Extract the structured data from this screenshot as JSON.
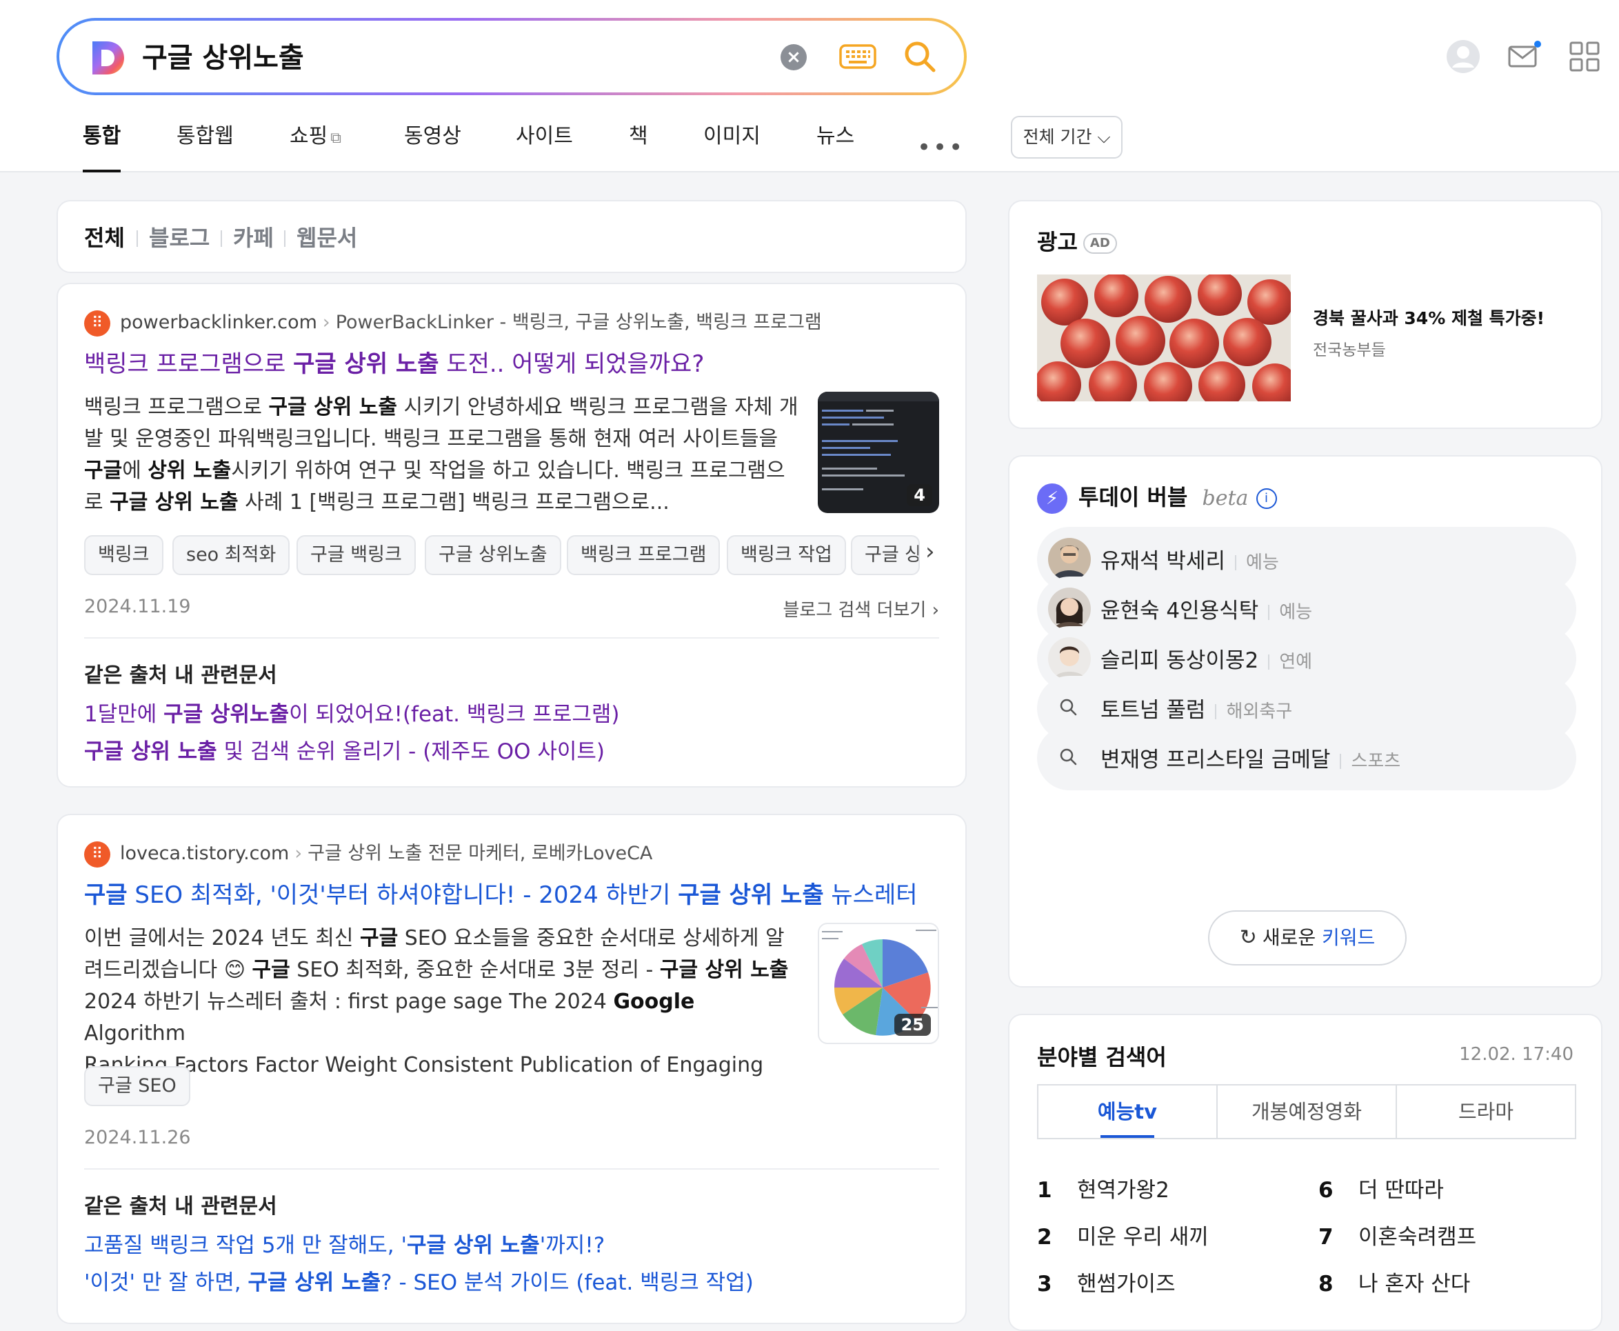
{
  "search": {
    "query": "구글 상위노출",
    "clear_glyph": "×",
    "icons": [
      "daum-logo-icon",
      "clear-icon",
      "keyboard-icon",
      "search-icon"
    ]
  },
  "header_icons": [
    "user-icon",
    "mail-icon",
    "grid-menu-icon"
  ],
  "tabs": [
    "통합",
    "통합웹",
    "쇼핑",
    "동영상",
    "사이트",
    "책",
    "이미지",
    "뉴스"
  ],
  "tabs_more": "•••",
  "period": "전체 기간 ⌵",
  "filters": [
    "전체",
    "블로그",
    "카페",
    "웹문서"
  ],
  "results": [
    {
      "domain": "powerbacklinker.com",
      "breadcrumb": "PowerBackLinker - 백링크, 구글 상위노출, 백링크 프로그램",
      "title_pre": "백링크 프로그램으로 ",
      "title_bold": "구글 상위 노출",
      "title_post": " 도전.. 어떻게 되었을까요?",
      "snippet": [
        [
          "백링크 프로그램으로 ",
          "구글 상위 노출",
          " 시키기 안녕하세요 백링크 프로그램을 자체 개"
        ],
        [
          "발 및 운영중인 파워백링크입니다. 백링크 프로그램을 통해 현재 여러 사이트들을",
          "",
          ""
        ],
        [
          "",
          "구글",
          "에 "
        ],
        [
          "로 ",
          "구글 상위 노출",
          " 사례 1 [백링크 프로그램] 백링크 프로그램으로..."
        ]
      ],
      "snippet_line3_b": "상위 노출",
      "snippet_line3_post": "시키기 위하여 연구 및 작업을 하고 있습니다. 백링크 프로그램으",
      "thumb_count": "4",
      "tags": [
        "백링크",
        "seo 최적화",
        "구글 백링크",
        "구글 상위노출",
        "백링크 프로그램",
        "백링크 작업",
        "구글 상"
      ],
      "date": "2024.11.19",
      "more": "블로그 검색 더보기 ›",
      "related_title": "같은 출처 내 관련문서",
      "related": [
        {
          "pre": "1달만에 ",
          "bold": "구글 상위노출",
          "post": "이 되었어요!(feat. 백링크 프로그램)"
        },
        {
          "pre": "",
          "bold": "구글 상위 노출",
          "post": " 및 검색 순위 올리기 - (제주도 OO 사이트)"
        }
      ]
    },
    {
      "domain": "loveca.tistory.com",
      "breadcrumb": "구글 상위 노출 전문 마케터, 로베카LoveCA",
      "title_a_bold": "구글",
      "title_a_mid": " SEO 최적화, '이것'부터 하셔야합니다! - 2024 하반기 ",
      "title_b_bold": "구글 상위 노출",
      "title_post": " 뉴스레터",
      "snippet_l1_pre": "이번 글에서는 2024 년도 최신 ",
      "snippet_l1_b": "구글",
      "snippet_l1_post": " SEO 요소들을 중요한 순서대로 상세하게 알",
      "snippet_l2_pre": "려드리겠습니다 😊 ",
      "snippet_l2_b1": "구글",
      "snippet_l2_mid": " SEO 최적화, 중요한 순서대로 3분 정리 - ",
      "snippet_l2_b2": "구글 상위 노출",
      "snippet_l3_pre": "2024 하반기 뉴스레터 출처 : first page sage The 2024 ",
      "snippet_l3_b": "Google",
      "snippet_l3_post": " Algorithm",
      "snippet_l4": "Ranking Factors Factor Weight Consistent Publication of Engaging Co...",
      "thumb_count": "25",
      "tags": [
        "구글 SEO"
      ],
      "date": "2024.11.26",
      "related_title": "같은 출처 내 관련문서",
      "related": [
        {
          "pre": "고품질 백링크 작업 5개 만 잘해도, '",
          "bold": "구글 상위 노출",
          "post": "'까지!?"
        },
        {
          "pre": "'이것' 만 잘 하면, ",
          "bold": "구글 상위 노출",
          "post": "? - SEO 분석 가이드 (feat. 백링크 작업)"
        }
      ]
    }
  ],
  "ad": {
    "title": "광고",
    "badge": "AD",
    "headline": "경북 꿀사과 34% 제철 특가중!",
    "seller": "전국농부들"
  },
  "bubble": {
    "title": "투데이 버블",
    "beta": "beta",
    "info": "i",
    "items": [
      {
        "keyword": "유재석 박세리",
        "category": "예능",
        "icon": "person-avatar"
      },
      {
        "keyword": "윤현숙 4인용식탁",
        "category": "예능",
        "icon": "person-avatar"
      },
      {
        "keyword": "슬리피 동상이몽2",
        "category": "연예",
        "icon": "person-avatar"
      },
      {
        "keyword": "토트넘 풀럼",
        "category": "해외축구",
        "icon": "search-icon"
      },
      {
        "keyword": "변재영 프리스타일 금메달",
        "category": "스포츠",
        "icon": "search-icon"
      }
    ],
    "refresh_pre": "새로운 ",
    "refresh_kw": "키워드"
  },
  "category_search": {
    "title": "분야별 검색어",
    "time": "12.02. 17:40",
    "tabs": [
      "예능tv",
      "개봉예정영화",
      "드라마"
    ],
    "ranks": [
      {
        "num": "1",
        "text": "현역가왕2"
      },
      {
        "num": "2",
        "text": "미운 우리 새끼"
      },
      {
        "num": "3",
        "text": "핸썸가이즈"
      },
      {
        "num": "6",
        "text": "더 딴따라"
      },
      {
        "num": "7",
        "text": "이혼숙려캠프"
      },
      {
        "num": "8",
        "text": "나 혼자 산다"
      }
    ]
  },
  "colors": {
    "accent": "#1a57d6",
    "visited": "#6a1fa5",
    "favicon": "#f05a28"
  }
}
